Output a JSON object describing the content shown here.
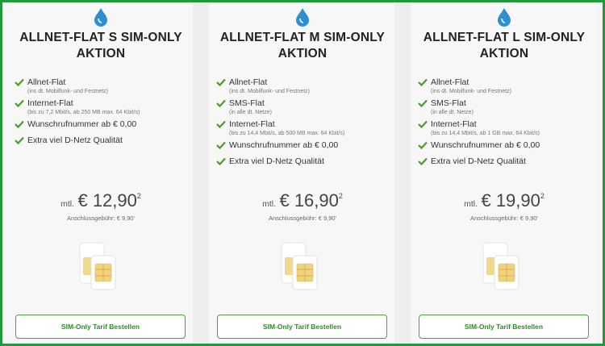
{
  "colors": {
    "frame": "#1f9a3b",
    "accent": "#4aa33a",
    "drop": "#2e8fd0",
    "check": "#4a9b2e"
  },
  "plans": [
    {
      "title_line1": "ALLNET-FLAT S SIM-ONLY",
      "title_line2": "AKTION",
      "features": [
        {
          "name": "Allnet-Flat",
          "sub": "(ins dt. Mobilfunk- und Festnetz)"
        },
        {
          "name": "Internet-Flat",
          "sub": "(bis zu 7,2 Mbit/s, ab 250 MB max. 64 Kbit/s)"
        },
        {
          "name": "Wunschrufnummer ab € 0,00",
          "sub": ""
        },
        {
          "name": "Extra viel D-Netz Qualität",
          "sub": ""
        }
      ],
      "price_prefix": "mtl.",
      "price": "€ 12,90",
      "price_sup": "2",
      "fee": "Anschlussgebühr: € 9,90'",
      "button": "SIM-Only Tarif Bestellen"
    },
    {
      "title_line1": "ALLNET-FLAT M SIM-ONLY",
      "title_line2": "AKTION",
      "features": [
        {
          "name": "Allnet-Flat",
          "sub": "(ins dt. Mobilfunk- und Festnetz)"
        },
        {
          "name": "SMS-Flat",
          "sub": "(in alle dt. Netze)"
        },
        {
          "name": "Internet-Flat",
          "sub": "(bis zu 14,4 Mbit/s, ab 500 MB max. 64 Kbit/s)"
        },
        {
          "name": "Wunschrufnummer ab € 0,00",
          "sub": ""
        },
        {
          "name": "Extra viel D-Netz Qualität",
          "sub": ""
        }
      ],
      "price_prefix": "mtl.",
      "price": "€ 16,90",
      "price_sup": "2",
      "fee": "Anschlussgebühr: € 9,90'",
      "button": "SIM-Only Tarif Bestellen"
    },
    {
      "title_line1": "ALLNET-FLAT L SIM-ONLY",
      "title_line2": "AKTION",
      "features": [
        {
          "name": "Allnet-Flat",
          "sub": "(ins dt. Mobilfunk- und Festnetz)"
        },
        {
          "name": "SMS-Flat",
          "sub": "(in alle dt. Netze)"
        },
        {
          "name": "Internet-Flat",
          "sub": "(bis zu 14,4 Mbit/s, ab 1 GB max. 64 Kbit/s)"
        },
        {
          "name": "Wunschrufnummer ab € 0,00",
          "sub": ""
        },
        {
          "name": "Extra viel D-Netz Qualität",
          "sub": ""
        }
      ],
      "price_prefix": "mtl.",
      "price": "€ 19,90",
      "price_sup": "2",
      "fee": "Anschlussgebühr: € 9,90'",
      "button": "SIM-Only Tarif Bestellen"
    }
  ]
}
